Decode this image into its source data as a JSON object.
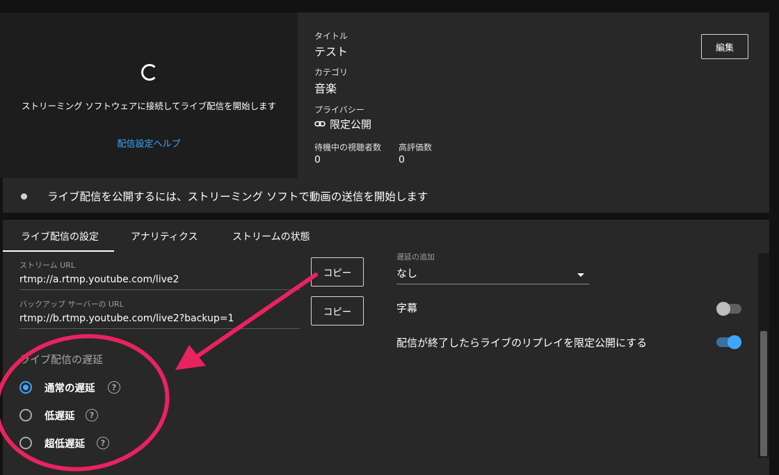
{
  "preview": {
    "message": "ストリーミング ソフトウェアに接続してライブ配信を開始します",
    "help_link": "配信設定ヘルプ"
  },
  "info": {
    "title_label": "タイトル",
    "title_value": "テスト",
    "category_label": "カテゴリ",
    "category_value": "音楽",
    "privacy_label": "プライバシー",
    "privacy_value": "限定公開",
    "waiting_viewers_label": "待機中の視聴者数",
    "waiting_viewers_value": "0",
    "likes_label": "高評価数",
    "likes_value": "0",
    "edit_button": "編集"
  },
  "status": {
    "text": "ライブ配信を公開するには、ストリーミング ソフトで動画の送信を開始します"
  },
  "tabs": [
    {
      "label": "ライブ配信の設定",
      "active": true
    },
    {
      "label": "アナリティクス",
      "active": false
    },
    {
      "label": "ストリームの状態",
      "active": false
    }
  ],
  "stream": {
    "url_label": "ストリーム URL",
    "url_value": "rtmp://a.rtmp.youtube.com/live2",
    "backup_label": "バックアップ サーバーの URL",
    "backup_value": "rtmp://b.rtmp.youtube.com/live2?backup=1",
    "copy_button": "コピー"
  },
  "latency": {
    "title": "ライブ配信の遅延",
    "options": [
      {
        "label": "通常の遅延",
        "checked": true
      },
      {
        "label": "低遅延",
        "checked": false
      },
      {
        "label": "超低遅延",
        "checked": false
      }
    ],
    "help_glyph": "?"
  },
  "right": {
    "delay_label": "遅延の追加",
    "delay_value": "なし",
    "captions_label": "字幕",
    "captions_on": false,
    "replay_label": "配信が終了したらライブのリプレイを限定公開にする",
    "replay_on": true
  },
  "colors": {
    "accent": "#3ea6ff",
    "annotation": "#e8235f"
  }
}
